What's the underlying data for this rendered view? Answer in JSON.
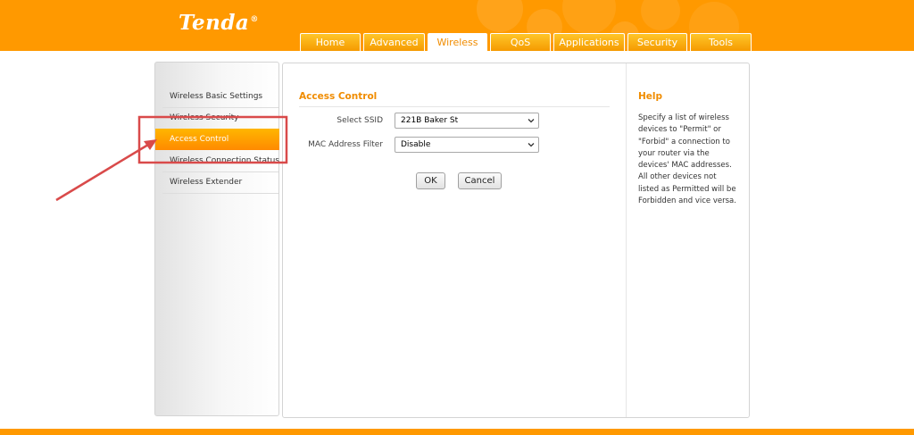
{
  "brand": {
    "logo_text": "Tenda"
  },
  "nav": {
    "tabs": [
      {
        "label": "Home",
        "active": false
      },
      {
        "label": "Advanced",
        "active": false
      },
      {
        "label": "Wireless",
        "active": true
      },
      {
        "label": "QoS",
        "active": false
      },
      {
        "label": "Applications",
        "active": false
      },
      {
        "label": "Security",
        "active": false
      },
      {
        "label": "Tools",
        "active": false
      }
    ]
  },
  "sidebar": {
    "items": [
      {
        "label": "Wireless Basic Settings",
        "active": false
      },
      {
        "label": "Wireless Security",
        "active": false
      },
      {
        "label": "Access Control",
        "active": true
      },
      {
        "label": "Wireless Connection Status",
        "active": false
      },
      {
        "label": "Wireless Extender",
        "active": false
      }
    ]
  },
  "main": {
    "title": "Access Control",
    "ssid_label": "Select SSID",
    "ssid_value": "221B Baker St",
    "mac_label": "MAC Address Filter",
    "mac_value": "Disable",
    "ok_label": "OK",
    "cancel_label": "Cancel"
  },
  "help": {
    "title": "Help",
    "text": "Specify a list of wireless devices to \"Permit\" or \"Forbid\" a connection to your router via the devices' MAC addresses. All other devices not listed as Permitted will be Forbidden and vice versa."
  },
  "colors": {
    "brand_orange": "#ff9900",
    "accent_text": "#f08c00",
    "annotation_red": "#d94a4a"
  }
}
